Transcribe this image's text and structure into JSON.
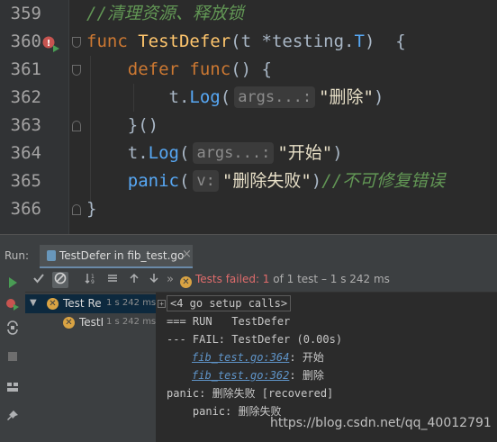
{
  "editor": {
    "lines": [
      {
        "num": "359",
        "comment": "//清理资源、释放锁"
      },
      {
        "num": "360",
        "kw_func": "func",
        "fn_name": "TestDefer",
        "open_paren": "(",
        "param": "t",
        "star": " *",
        "pkg": "testing.",
        "type": "T",
        "close": ")  {"
      },
      {
        "num": "361",
        "kw_defer": "defer",
        "kw_func": "func",
        "rest": "() {"
      },
      {
        "num": "362",
        "recv": "t.",
        "method": "Log",
        "open_paren": "(",
        "hint": "args...:",
        "str": "\"删除\"",
        "close": ")"
      },
      {
        "num": "363",
        "text": "}()"
      },
      {
        "num": "364",
        "recv": "t.",
        "method": "Log",
        "open_paren": "(",
        "hint": "args...:",
        "str": "\"开始\"",
        "close": ")"
      },
      {
        "num": "365",
        "method": "panic",
        "open_paren": "(",
        "hint": "v:",
        "str": "\"删除失败\"",
        "close": ")",
        "comment": "//不可修复错误"
      },
      {
        "num": "366",
        "text": "}"
      }
    ]
  },
  "run_panel": {
    "label": "Run:",
    "tab_title": "TestDefer in fib_test.go",
    "tab_close": "×",
    "status_fail": "Tests failed: 1",
    "status_rest": " of 1 test – 1 s 242 ms",
    "toolbar_icons": [
      "check-icon",
      "cancel-icon",
      "sort-icon",
      "collapse-icon",
      "arrow-up-icon",
      "arrow-down-icon",
      "forward-icon",
      "more-icon"
    ],
    "tree": [
      {
        "name": "Test Re",
        "duration": "1 s 242 ms"
      },
      {
        "name": "TestI",
        "duration": "1 s 242 ms"
      }
    ],
    "console": {
      "setup_calls": "<4 go setup calls>",
      "line_run": "=== RUN   TestDefer",
      "line_fail": "--- FAIL: TestDefer (0.00s)",
      "link1": "fib_test.go:364",
      "msg1": ": 开始",
      "link2": "fib_test.go:362",
      "msg2": ": 删除",
      "panic_line": "panic: 删除失败 [recovered]",
      "panic_line2": "    panic: 删除失败"
    }
  },
  "watermark": "https://blog.csdn.net/qq_40012791",
  "colors": {
    "keyword": "#cc7832",
    "function": "#ffc66d",
    "type": "#9876aa",
    "comment": "#629755",
    "fail": "#e06c6c",
    "run_green": "#499c54"
  }
}
